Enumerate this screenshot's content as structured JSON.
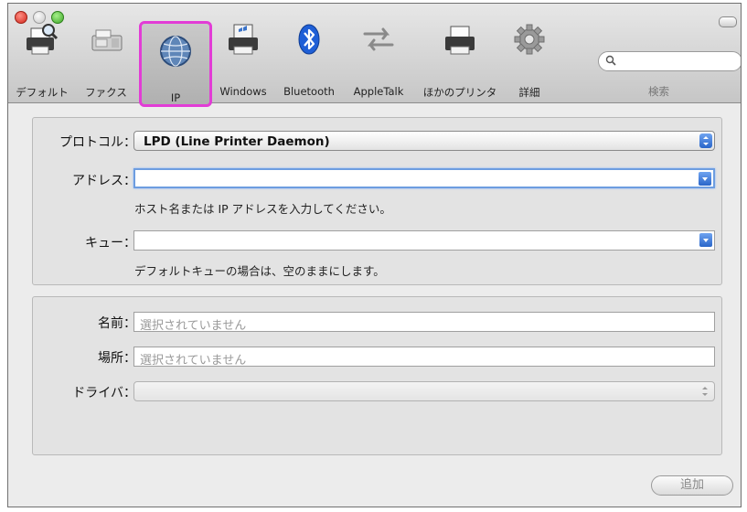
{
  "toolbar": {
    "items": [
      {
        "label": "デフォルト",
        "icon": "printer-magnifier-icon"
      },
      {
        "label": "ファクス",
        "icon": "fax-icon"
      },
      {
        "label": "IP",
        "icon": "globe-icon",
        "selected": true
      },
      {
        "label": "Windows",
        "icon": "windows-printer-icon"
      },
      {
        "label": "Bluetooth",
        "icon": "bluetooth-icon"
      },
      {
        "label": "AppleTalk",
        "icon": "appletalk-arrows-icon"
      },
      {
        "label": "ほかのプリンタ",
        "icon": "printer-icon"
      },
      {
        "label": "詳細",
        "icon": "gear-icon"
      }
    ],
    "search": {
      "placeholder": "",
      "label": "検索"
    }
  },
  "connection": {
    "protocol_label": "プロトコル：",
    "protocol_value": "LPD (Line Printer Daemon)",
    "address_label": "アドレス：",
    "address_value": "",
    "address_hint": "ホスト名または IP アドレスを入力してください。",
    "queue_label": "キュー：",
    "queue_value": "",
    "queue_hint": "デフォルトキューの場合は、空のままにします。"
  },
  "details": {
    "name_label": "名前：",
    "name_placeholder": "選択されていません",
    "location_label": "場所：",
    "location_placeholder": "選択されていません",
    "driver_label": "ドライバ：",
    "driver_value": ""
  },
  "footer": {
    "add_button": "追加"
  },
  "colors": {
    "selection_highlight": "#e23cd6",
    "focus_ring": "#6d9de0"
  }
}
